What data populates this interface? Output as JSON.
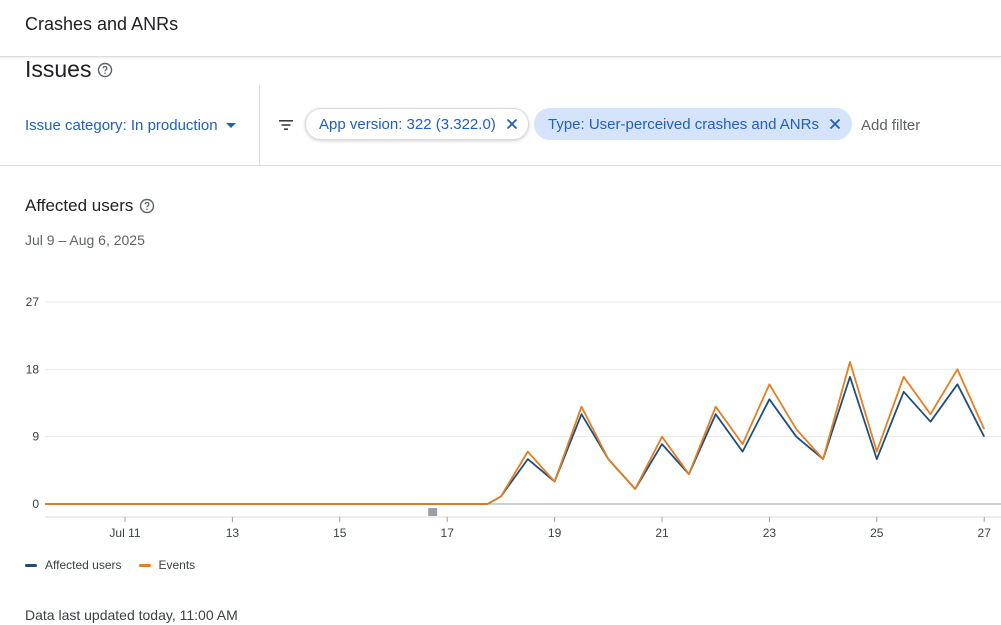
{
  "header": {
    "title": "Crashes and ANRs"
  },
  "page": {
    "title": "Issues",
    "help_icon": "help-circle-icon"
  },
  "filters": {
    "issue_category_label": "Issue category: In production",
    "chips": [
      {
        "label": "App version: 322 (3.322.0)",
        "style": "outlined"
      },
      {
        "label": "Type: User-perceived crashes and ANRs",
        "style": "filled"
      }
    ],
    "add_filter_placeholder": "Add filter",
    "filter_icon": "filter-list-icon",
    "remove_icon": "close-icon"
  },
  "section": {
    "title": "Affected users",
    "date_range": "Jul 9 – Aug 6, 2025"
  },
  "colors": {
    "affected_users": "#1f4e79",
    "events": "#e67e22",
    "accent": "#1f5fbf"
  },
  "chart_data": {
    "type": "line",
    "x_tick_labels": [
      "Jul 11",
      "13",
      "15",
      "17",
      "19",
      "21",
      "23",
      "25",
      "27"
    ],
    "y_ticks": [
      0,
      9,
      18,
      27
    ],
    "ylim": [
      0,
      27
    ],
    "grid": true,
    "legend_position": "bottom-left",
    "series": [
      {
        "name": "Affected users",
        "x": [
          18.0,
          18.5,
          19.0,
          19.5,
          20.0,
          20.5,
          21.0,
          21.5,
          22.0,
          22.5,
          23.0,
          23.5,
          24.0,
          24.5,
          25.0,
          25.5,
          26.0,
          26.5,
          27.0
        ],
        "values": [
          1,
          6,
          3,
          12,
          6,
          2,
          8,
          4,
          12,
          7,
          14,
          9,
          6,
          17,
          6,
          15,
          11,
          16,
          9
        ]
      },
      {
        "name": "Events",
        "x": [
          18.0,
          18.5,
          19.0,
          19.5,
          20.0,
          20.5,
          21.0,
          21.5,
          22.0,
          22.5,
          23.0,
          23.5,
          24.0,
          24.5,
          25.0,
          25.5,
          26.0,
          26.5,
          27.0
        ],
        "values": [
          1,
          7,
          3,
          13,
          6,
          2,
          9,
          4,
          13,
          8,
          16,
          10,
          6,
          19,
          7,
          17,
          12,
          18,
          10
        ]
      }
    ]
  },
  "footer": {
    "text": "Data last updated today, 11:00 AM"
  }
}
